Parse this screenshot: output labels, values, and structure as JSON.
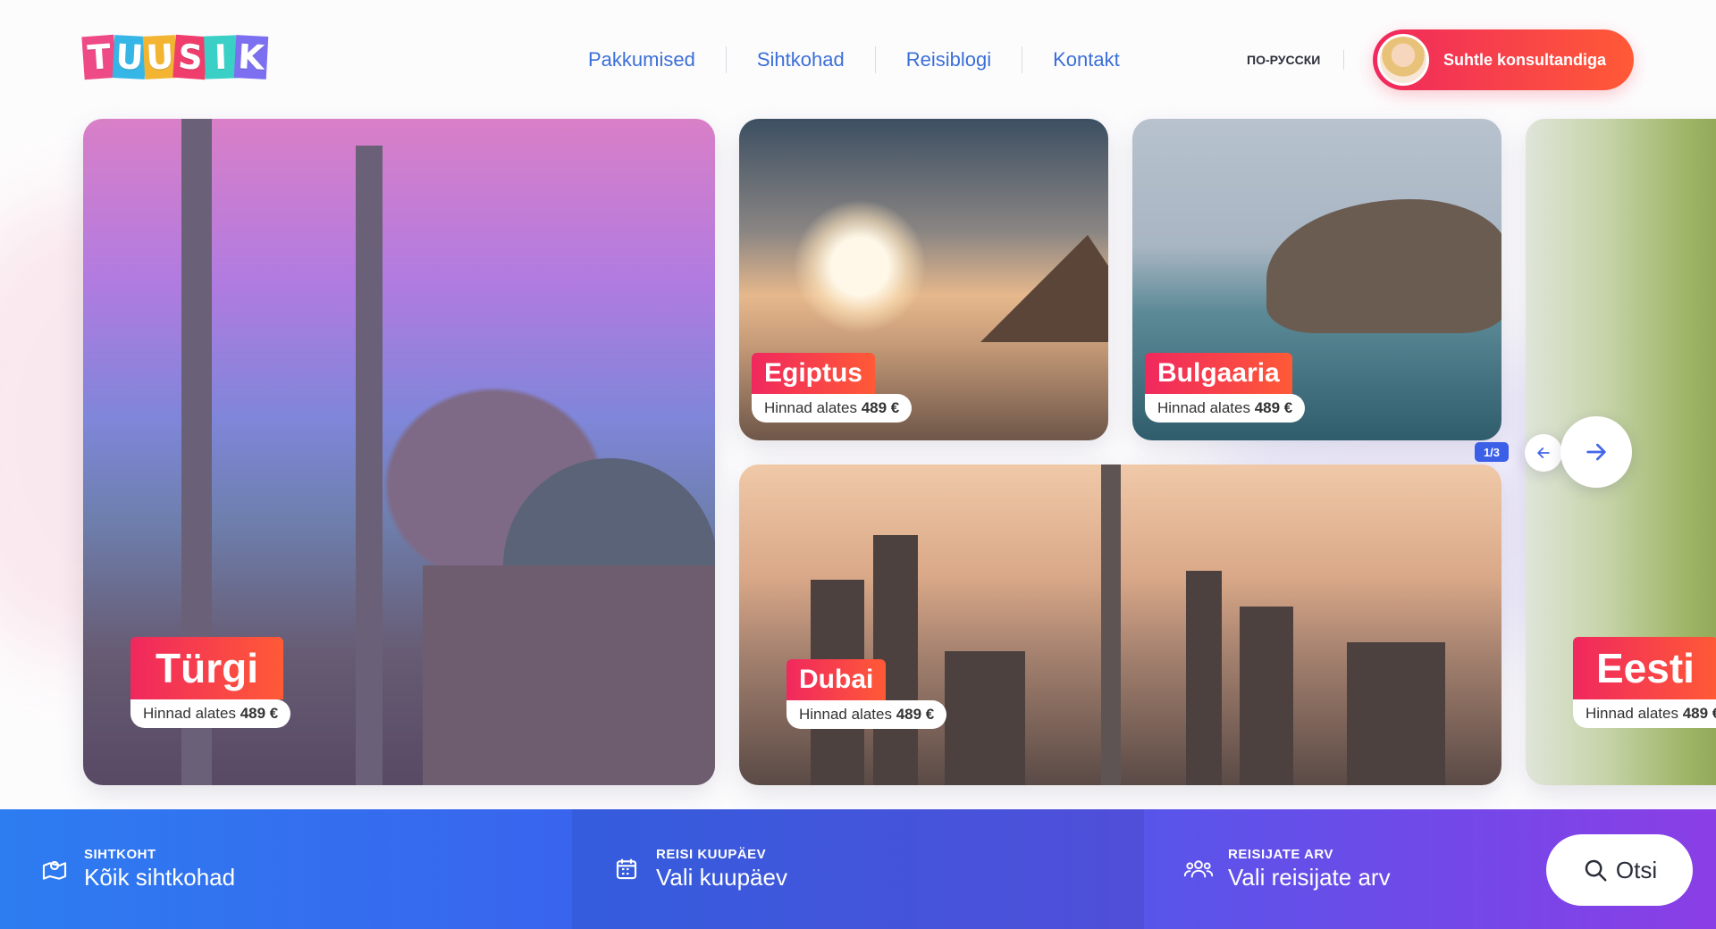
{
  "brand": {
    "logo_letters": [
      "T",
      "U",
      "U",
      "S",
      "I",
      "K"
    ]
  },
  "nav": {
    "items": [
      {
        "label": "Pakkumised"
      },
      {
        "label": "Sihtkohad"
      },
      {
        "label": "Reisiblogi"
      },
      {
        "label": "Kontakt"
      }
    ]
  },
  "header": {
    "language": "ПО-РУССКИ",
    "consultant_button": "Suhtle konsultandiga"
  },
  "destinations": [
    {
      "name": "Türgi",
      "price_prefix": "Hinnad alates",
      "price": "489 €"
    },
    {
      "name": "Egiptus",
      "price_prefix": "Hinnad alates",
      "price": "489 €"
    },
    {
      "name": "Bulgaaria",
      "price_prefix": "Hinnad alates",
      "price": "489 €"
    },
    {
      "name": "Dubai",
      "price_prefix": "Hinnad alates",
      "price": "489 €"
    },
    {
      "name": "Eesti",
      "price_prefix": "Hinnad alates",
      "price": "489 €"
    }
  ],
  "carousel": {
    "counter": "1/3"
  },
  "search": {
    "destination": {
      "caption": "SIHTKOHT",
      "value": "Kõik sihtkohad"
    },
    "date": {
      "caption": "REISI KUUPÄEV",
      "value": "Vali kuupäev"
    },
    "travellers": {
      "caption": "REISIJATE ARV",
      "value": "Vali reisijate arv"
    },
    "button": "Otsi"
  },
  "colors": {
    "accent_gradient_start": "#f0285e",
    "accent_gradient_end": "#ff5a36",
    "nav_link": "#3a6fd8",
    "search_bar_start": "#2d7cf0",
    "search_bar_end": "#8a3ee6"
  }
}
